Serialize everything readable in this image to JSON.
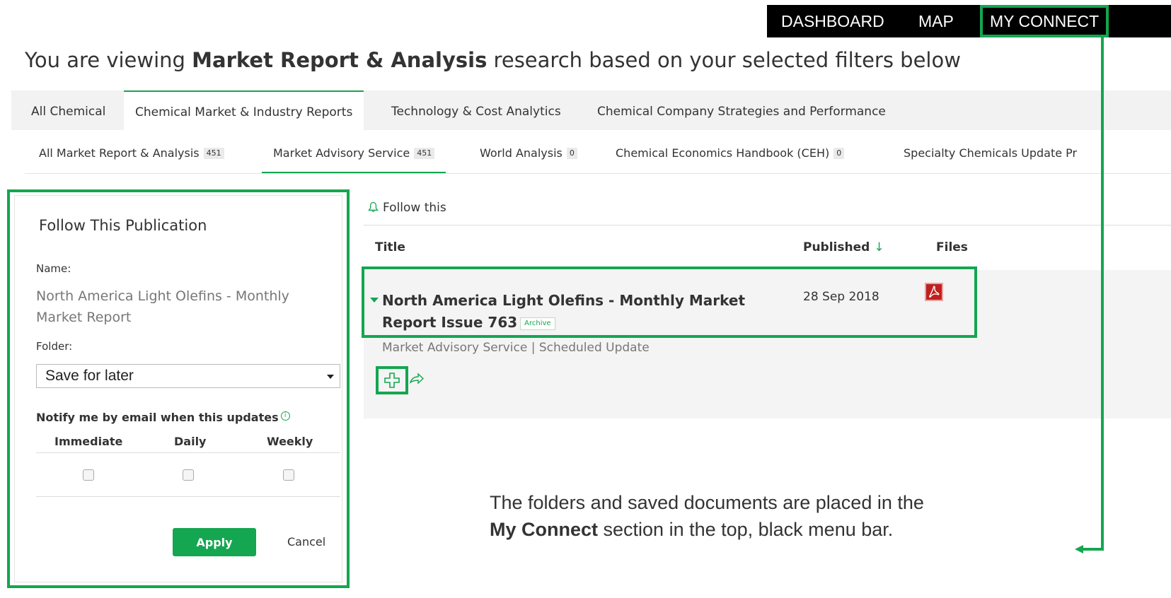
{
  "topnav": {
    "items": [
      "DASHBOARD",
      "MAP",
      "MY CONNECT"
    ]
  },
  "heading": {
    "prefix": "You are viewing ",
    "bold": "Market Report & Analysis",
    "suffix": " research based on your selected filters below"
  },
  "tabs": [
    {
      "label": "All Chemical",
      "active": false
    },
    {
      "label": "Chemical Market & Industry Reports",
      "active": true
    },
    {
      "label": "Technology & Cost Analytics",
      "active": false
    },
    {
      "label": "Chemical Company Strategies and Performance",
      "active": false
    }
  ],
  "subtabs": [
    {
      "label": "All Market Report & Analysis",
      "count": "451"
    },
    {
      "label": "Market Advisory Service",
      "count": "451"
    },
    {
      "label": "World Analysis",
      "count": "0"
    },
    {
      "label": "Chemical Economics Handbook (CEH)",
      "count": "0"
    },
    {
      "label": "Specialty Chemicals Update Pr"
    }
  ],
  "follow_panel": {
    "title": "Follow This Publication",
    "name_label": "Name:",
    "name_value": "North America Light Olefins - Monthly Market Report",
    "folder_label": "Folder:",
    "folder_value": "Save for later",
    "notify_label": "Notify me by email when this updates",
    "info_symbol": "i",
    "frequencies": [
      "Immediate",
      "Daily",
      "Weekly"
    ],
    "apply_label": "Apply",
    "cancel_label": "Cancel"
  },
  "results": {
    "follow_label": "Follow this",
    "columns": {
      "title": "Title",
      "published": "Published",
      "files": "Files"
    },
    "sort_symbol": "↓",
    "item": {
      "title": "North America Light Olefins - Monthly Market Report Issue 763",
      "badge": "Archive",
      "date": "28 Sep 2018",
      "meta": "Market Advisory Service | Scheduled Update"
    }
  },
  "annotation": {
    "line1": "The folders and saved documents are placed in the",
    "line2_bold": "My Connect",
    "line2_rest": " section in the top, black menu bar."
  },
  "colors": {
    "accent": "#14a650",
    "topbar": "#000000",
    "pdf": "#c0201e"
  }
}
